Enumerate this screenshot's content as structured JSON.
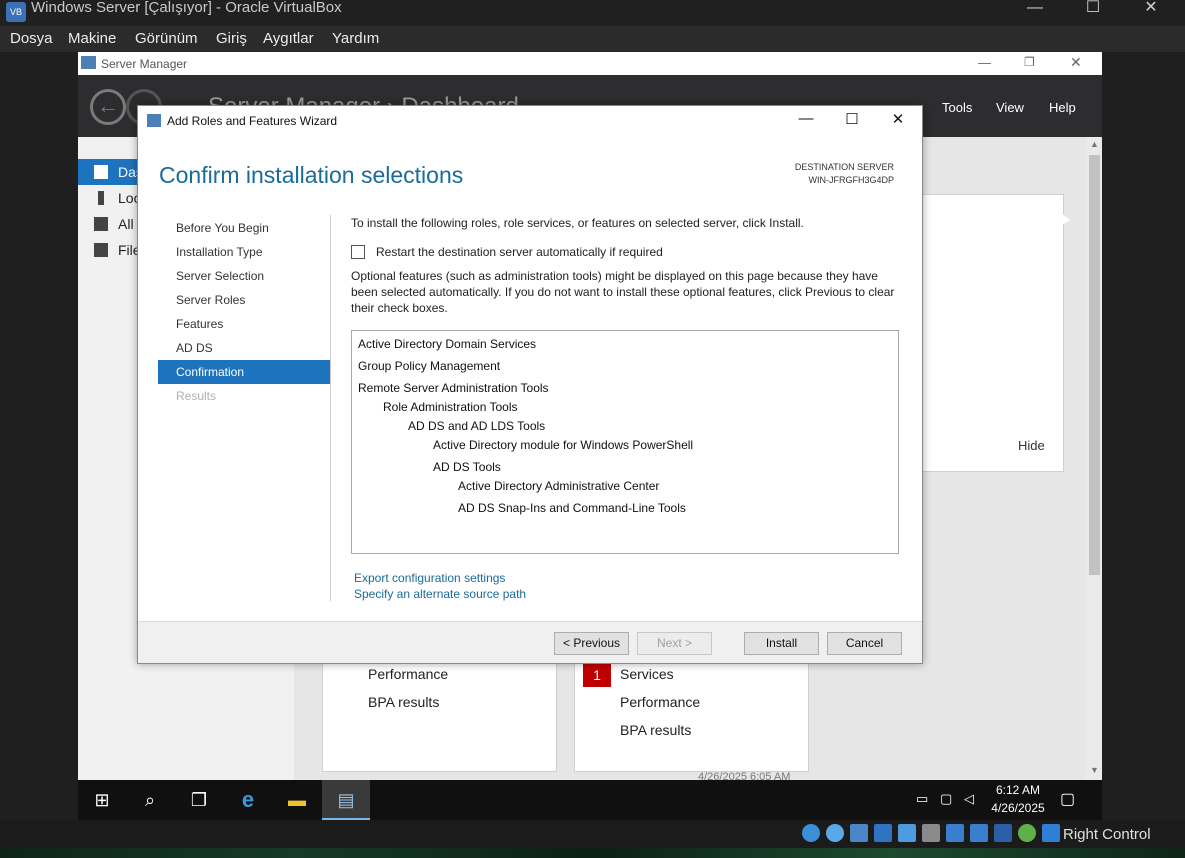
{
  "host_window": {
    "title": "Windows Server  [Çalışıyor] - Oracle VirtualBox",
    "controls": {
      "minimize": "—",
      "maximize": "☐",
      "close": "✕"
    }
  },
  "host_menu": [
    "Dosya",
    "Makine",
    "Görünüm",
    "Giriş",
    "Aygıtlar",
    "Yardım"
  ],
  "server_manager": {
    "title": "Server Manager",
    "breadcrumb": "Server Manager › Dashboard",
    "menu": [
      "Tools",
      "View",
      "Help"
    ],
    "sidebar": [
      {
        "label": "Das",
        "icon": "dashboard-icon",
        "active": true
      },
      {
        "label": "Loc",
        "icon": "local-server-icon"
      },
      {
        "label": "All",
        "icon": "all-servers-icon"
      },
      {
        "label": "File",
        "icon": "file-services-icon"
      }
    ],
    "welcome_hide": "Hide",
    "tiles": [
      {
        "rows": [
          "Performance",
          "BPA results"
        ]
      },
      {
        "badge": "1",
        "rows": [
          "Services",
          "Performance",
          "BPA results"
        ]
      }
    ],
    "timestamp": "4/26/2025 6:05 AM"
  },
  "wizard": {
    "title": "Add Roles and Features Wizard",
    "heading": "Confirm installation selections",
    "destination_label": "DESTINATION SERVER",
    "destination_server": "WIN-JFRGFH3G4DP",
    "steps": [
      {
        "label": "Before You Begin",
        "state": "normal"
      },
      {
        "label": "Installation Type",
        "state": "normal"
      },
      {
        "label": "Server Selection",
        "state": "normal"
      },
      {
        "label": "Server Roles",
        "state": "normal"
      },
      {
        "label": "Features",
        "state": "normal"
      },
      {
        "label": "AD DS",
        "state": "normal"
      },
      {
        "label": "Confirmation",
        "state": "active"
      },
      {
        "label": "Results",
        "state": "disabled"
      }
    ],
    "intro": "To install the following roles, role services, or features on selected server, click Install.",
    "restart_checkbox": {
      "label": "Restart the destination server automatically if required",
      "checked": false
    },
    "optional_note": "Optional features (such as administration tools) might be displayed on this page because they have been selected automatically. If you do not want to install these optional features, click Previous to clear their check boxes.",
    "selections": [
      {
        "label": "Active Directory Domain Services",
        "level": 0
      },
      {
        "label": "Group Policy Management",
        "level": 0
      },
      {
        "label": "Remote Server Administration Tools",
        "level": 0
      },
      {
        "label": "Role Administration Tools",
        "level": 1
      },
      {
        "label": "AD DS and AD LDS Tools",
        "level": 2
      },
      {
        "label": "Active Directory module for Windows PowerShell",
        "level": 3
      },
      {
        "label": "AD DS Tools",
        "level": 3
      },
      {
        "label": "Active Directory Administrative Center",
        "level": 4
      },
      {
        "label": "AD DS Snap-Ins and Command-Line Tools",
        "level": 4
      }
    ],
    "links": [
      "Export configuration settings",
      "Specify an alternate source path"
    ],
    "buttons": {
      "previous": "< Previous",
      "next": "Next >",
      "install": "Install",
      "cancel": "Cancel"
    }
  },
  "taskbar": {
    "time": "6:12 AM",
    "date": "4/26/2025",
    "icons": [
      "start-icon",
      "search-icon",
      "task-view-icon",
      "internet-explorer-icon",
      "file-explorer-icon",
      "server-manager-icon"
    ]
  },
  "vb_status": {
    "host_key": "Right Control"
  }
}
